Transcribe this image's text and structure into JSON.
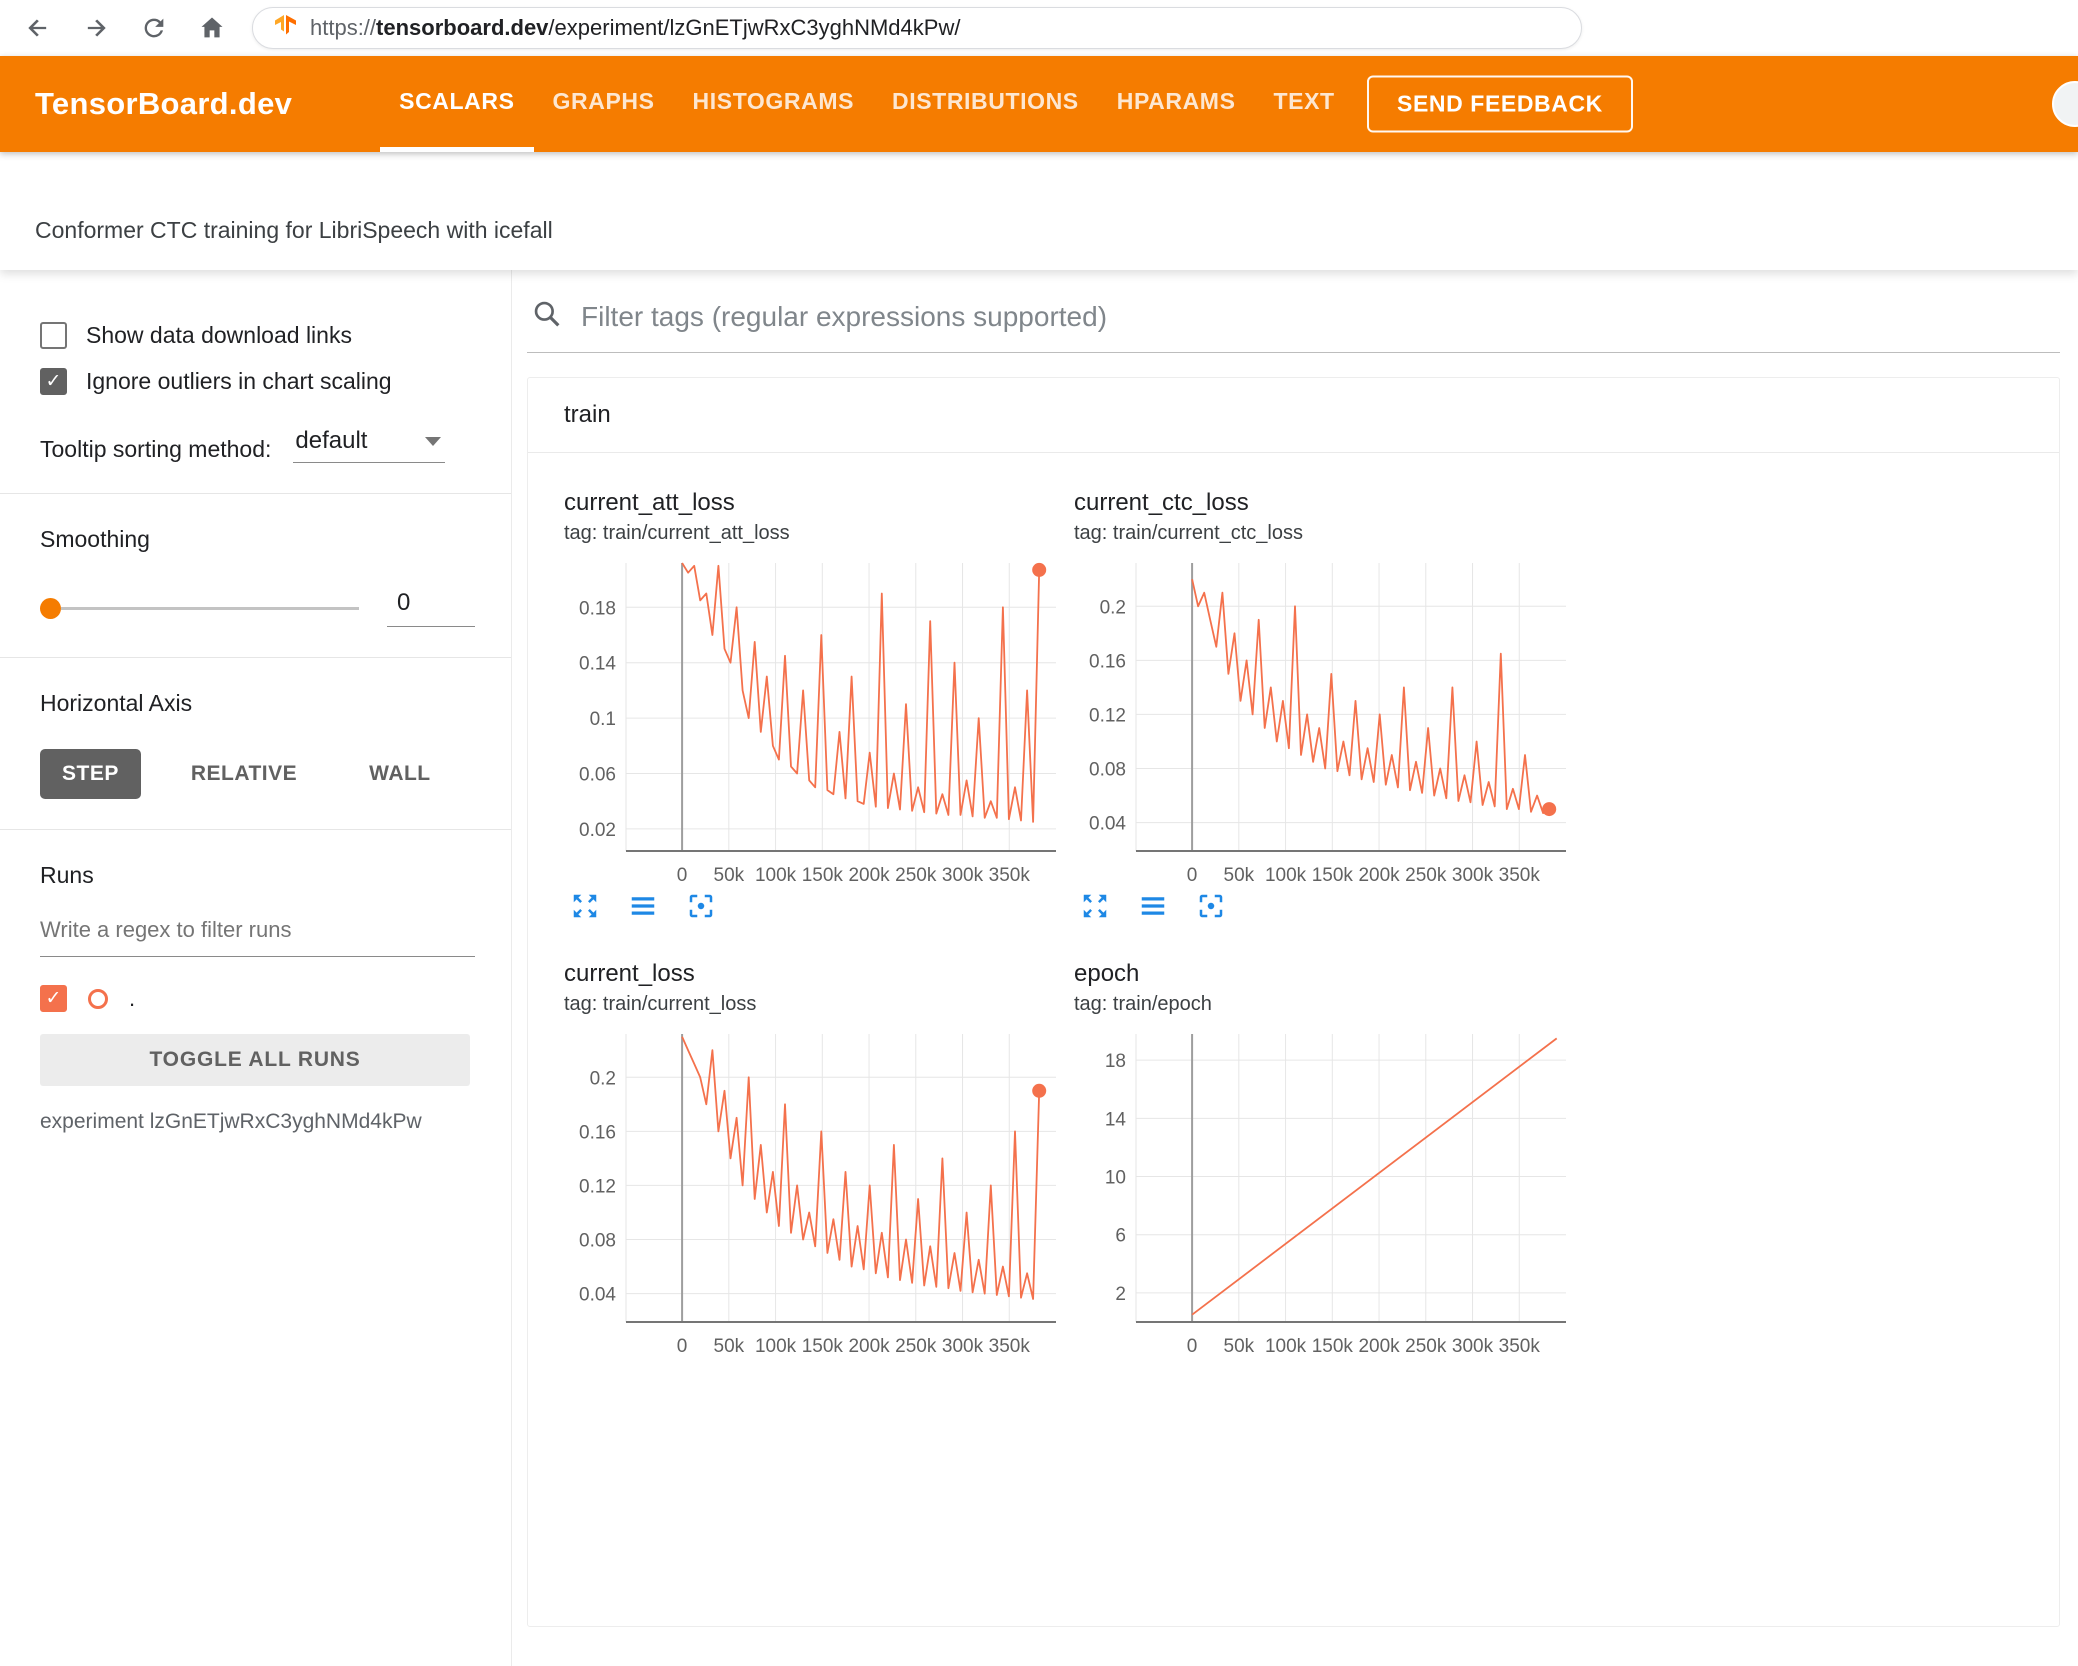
{
  "browser": {
    "url_scheme": "https://",
    "url_host": "tensorboard.dev",
    "url_path": "/experiment/lzGnETjwRxC3yghNMd4kPw/"
  },
  "header": {
    "logo": "TensorBoard.dev",
    "tabs": [
      {
        "label": "SCALARS",
        "active": true
      },
      {
        "label": "GRAPHS",
        "active": false
      },
      {
        "label": "HISTOGRAMS",
        "active": false
      },
      {
        "label": "DISTRIBUTIONS",
        "active": false
      },
      {
        "label": "HPARAMS",
        "active": false
      },
      {
        "label": "TEXT",
        "active": false
      }
    ],
    "feedback_button": "SEND FEEDBACK"
  },
  "experiment": {
    "title": "Conformer CTC training for LibriSpeech with icefall"
  },
  "sidebar": {
    "show_download": {
      "label": "Show data download links",
      "checked": false
    },
    "ignore_outliers": {
      "label": "Ignore outliers in chart scaling",
      "checked": true
    },
    "tooltip_sorting": {
      "label": "Tooltip sorting method:",
      "value": "default"
    },
    "smoothing": {
      "label": "Smoothing",
      "value": "0"
    },
    "horizontal_axis": {
      "label": "Horizontal Axis",
      "options": [
        "STEP",
        "RELATIVE",
        "WALL"
      ],
      "selected": "STEP"
    },
    "runs": {
      "label": "Runs",
      "filter_placeholder": "Write a regex to filter runs",
      "run_label": ".",
      "run_checked": true,
      "toggle_button": "TOGGLE ALL RUNS",
      "experiment_note": "experiment lzGnETjwRxC3yghNMd4kPw"
    }
  },
  "main": {
    "filter_placeholder": "Filter tags (regular expressions supported)",
    "section": "train"
  },
  "icons": {
    "search-icon": "magnifier",
    "back-icon": "left-arrow",
    "forward-icon": "right-arrow",
    "reload-icon": "circular-arrow",
    "home-icon": "house",
    "expand-icon": "four-corner-arrows-out",
    "horizontal-lines-icon": "three-horizontal-bars",
    "fit-domain-icon": "crop-frame-with-dot",
    "chevron-down-icon": "css-triangle"
  },
  "colors": {
    "accent": "#f57c00",
    "run": "#f4714c",
    "blue": "#1e88e5",
    "seg": "#616161"
  },
  "chart_data": [
    {
      "type": "line",
      "title": "current_att_loss",
      "tag": "tag: train/current_att_loss",
      "x_start": 0,
      "x_step": 6475,
      "values": [
        0.215,
        0.205,
        0.21,
        0.185,
        0.19,
        0.16,
        0.21,
        0.15,
        0.14,
        0.18,
        0.12,
        0.1,
        0.155,
        0.09,
        0.13,
        0.08,
        0.07,
        0.145,
        0.065,
        0.06,
        0.12,
        0.055,
        0.05,
        0.16,
        0.048,
        0.045,
        0.09,
        0.042,
        0.13,
        0.04,
        0.038,
        0.075,
        0.036,
        0.19,
        0.035,
        0.06,
        0.034,
        0.11,
        0.033,
        0.05,
        0.032,
        0.17,
        0.031,
        0.045,
        0.03,
        0.14,
        0.03,
        0.055,
        0.029,
        0.1,
        0.028,
        0.04,
        0.028,
        0.18,
        0.027,
        0.05,
        0.026,
        0.12,
        0.025,
        0.207
      ],
      "end_dot": true,
      "xlim": [
        -60000,
        400000
      ],
      "ylim": [
        0.004,
        0.212
      ],
      "xtick_values": [
        0,
        50000,
        100000,
        150000,
        200000,
        250000,
        300000,
        350000
      ],
      "xtick_labels": [
        "0",
        "50k",
        "100k",
        "150k",
        "200k",
        "250k",
        "300k",
        "350k"
      ],
      "ytick_values": [
        0.02,
        0.06,
        0.1,
        0.14,
        0.18
      ],
      "ytick_labels": [
        "0.02",
        "0.06",
        "0.1",
        "0.14",
        "0.18"
      ],
      "grid": true,
      "legend": "none"
    },
    {
      "type": "line",
      "title": "current_ctc_loss",
      "tag": "tag: train/current_ctc_loss",
      "x_start": 0,
      "x_step": 6475,
      "values": [
        0.22,
        0.2,
        0.21,
        0.19,
        0.17,
        0.21,
        0.15,
        0.18,
        0.13,
        0.16,
        0.12,
        0.19,
        0.11,
        0.14,
        0.1,
        0.13,
        0.095,
        0.2,
        0.09,
        0.12,
        0.085,
        0.11,
        0.08,
        0.15,
        0.078,
        0.1,
        0.075,
        0.13,
        0.072,
        0.095,
        0.07,
        0.12,
        0.068,
        0.09,
        0.066,
        0.14,
        0.064,
        0.085,
        0.062,
        0.11,
        0.06,
        0.08,
        0.058,
        0.14,
        0.056,
        0.075,
        0.055,
        0.1,
        0.053,
        0.07,
        0.052,
        0.165,
        0.05,
        0.065,
        0.05,
        0.09,
        0.048,
        0.06,
        0.047,
        0.05
      ],
      "end_dot": true,
      "xlim": [
        -60000,
        400000
      ],
      "ylim": [
        0.019,
        0.232
      ],
      "xtick_values": [
        0,
        50000,
        100000,
        150000,
        200000,
        250000,
        300000,
        350000
      ],
      "xtick_labels": [
        "0",
        "50k",
        "100k",
        "150k",
        "200k",
        "250k",
        "300k",
        "350k"
      ],
      "ytick_values": [
        0.04,
        0.08,
        0.12,
        0.16,
        0.2
      ],
      "ytick_labels": [
        "0.04",
        "0.08",
        "0.12",
        "0.16",
        "0.2"
      ],
      "grid": true,
      "legend": "none"
    },
    {
      "type": "line",
      "title": "current_loss",
      "tag": "tag: train/current_loss",
      "x_start": 0,
      "x_step": 6475,
      "values": [
        0.23,
        0.22,
        0.21,
        0.2,
        0.18,
        0.22,
        0.16,
        0.19,
        0.14,
        0.17,
        0.12,
        0.2,
        0.11,
        0.15,
        0.1,
        0.13,
        0.09,
        0.18,
        0.085,
        0.12,
        0.08,
        0.1,
        0.075,
        0.16,
        0.07,
        0.095,
        0.065,
        0.13,
        0.06,
        0.09,
        0.058,
        0.12,
        0.055,
        0.085,
        0.052,
        0.15,
        0.05,
        0.08,
        0.048,
        0.11,
        0.046,
        0.075,
        0.045,
        0.14,
        0.044,
        0.07,
        0.042,
        0.1,
        0.041,
        0.065,
        0.04,
        0.12,
        0.039,
        0.06,
        0.038,
        0.16,
        0.037,
        0.055,
        0.036,
        0.19
      ],
      "end_dot": true,
      "xlim": [
        -60000,
        400000
      ],
      "ylim": [
        0.019,
        0.232
      ],
      "xtick_values": [
        0,
        50000,
        100000,
        150000,
        200000,
        250000,
        300000,
        350000
      ],
      "xtick_labels": [
        "0",
        "50k",
        "100k",
        "150k",
        "200k",
        "250k",
        "300k",
        "350k"
      ],
      "ytick_values": [
        0.04,
        0.08,
        0.12,
        0.16,
        0.2
      ],
      "ytick_labels": [
        "0.04",
        "0.08",
        "0.12",
        "0.16",
        "0.2"
      ],
      "grid": true,
      "legend": "none"
    },
    {
      "type": "line",
      "title": "epoch",
      "tag": "tag: train/epoch",
      "points": [
        [
          0,
          0.5
        ],
        [
          390000,
          19.5
        ]
      ],
      "end_dot": false,
      "xlim": [
        -60000,
        400000
      ],
      "ylim": [
        0,
        19.8
      ],
      "xtick_values": [
        0,
        50000,
        100000,
        150000,
        200000,
        250000,
        300000,
        350000
      ],
      "xtick_labels": [
        "0",
        "50k",
        "100k",
        "150k",
        "200k",
        "250k",
        "300k",
        "350k"
      ],
      "ytick_values": [
        2,
        6,
        10,
        14,
        18
      ],
      "ytick_labels": [
        "2",
        "6",
        "10",
        "14",
        "18"
      ],
      "grid": true,
      "legend": "none"
    }
  ]
}
